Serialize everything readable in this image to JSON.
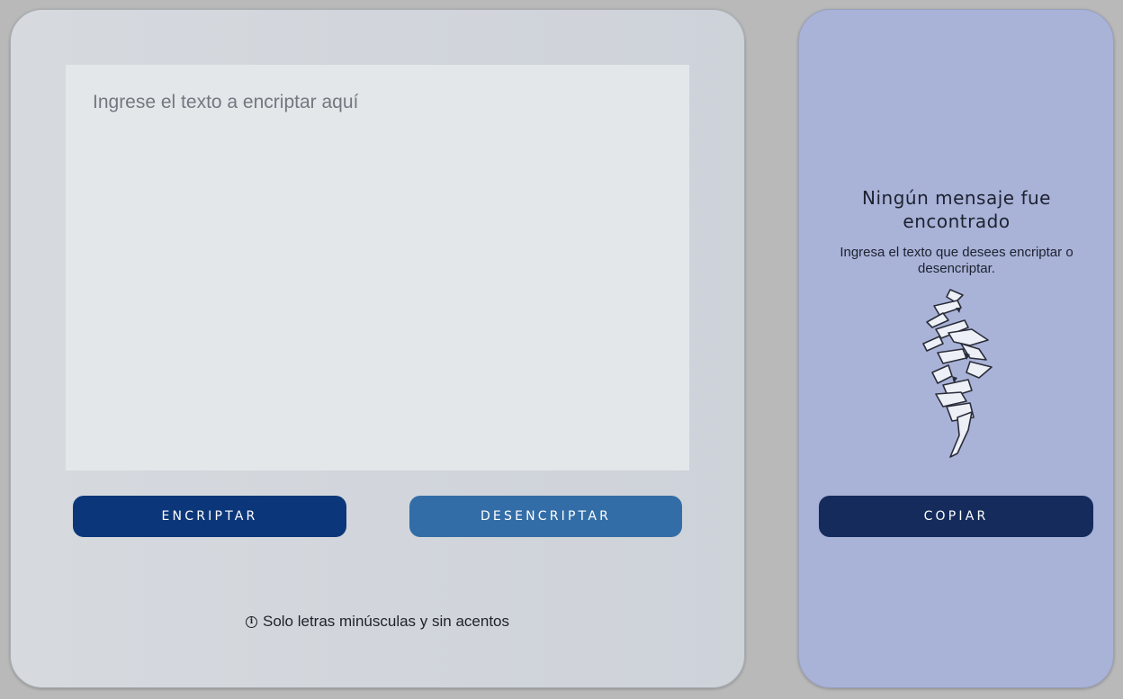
{
  "input": {
    "placeholder": "Ingrese el texto a encriptar aquí",
    "value": ""
  },
  "buttons": {
    "encrypt_label": "ENCRIPTAR",
    "decrypt_label": "DESENCRIPTAR",
    "copy_label": "COPIAR"
  },
  "notice": {
    "icon": "info-icon",
    "text": "Solo letras minúsculas y sin acentos"
  },
  "output": {
    "title": "Ningún mensaje fue encontrado",
    "subtitle": "Ingresa el texto que desees encriptar o desencriptar.",
    "illustration": "calligraphy-symbol-image"
  },
  "colors": {
    "encrypt_button": "#0b377a",
    "decrypt_button": "#336da7",
    "copy_button": "#142b5c",
    "output_panel": "#a9b2d7",
    "input_panel": "#d3d7dd"
  }
}
